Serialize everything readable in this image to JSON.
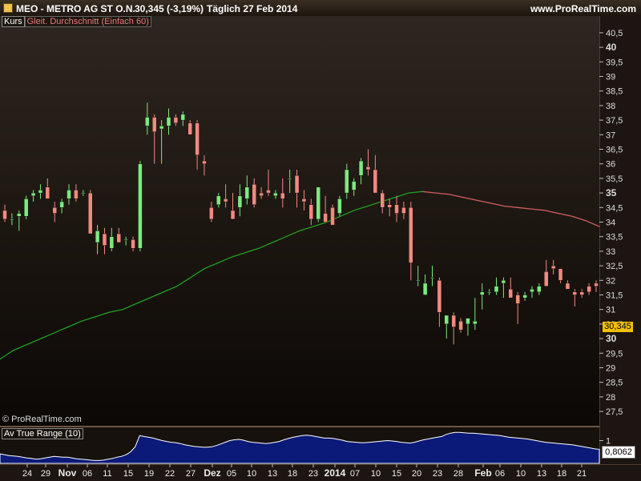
{
  "header": {
    "symbol": "MEO - METRO AG ST O.N.",
    "price_change": "30,345 (-3,19%)",
    "interval_date": "Täglich  27 Feb 2014",
    "site": "www.ProRealTime.com",
    "swatch_color": "#f2c34c"
  },
  "legend": {
    "kurs": "Kurs",
    "ma": "Gleit. Durchschnitt (Einfach 60)"
  },
  "copyright": "© ProRealTime.com",
  "atr": {
    "label": "Av True Range (10)",
    "value": "0,8062",
    "axis_tick": "1"
  },
  "current_price": "30,345",
  "x_ticks": [
    "24",
    "29",
    "Nov",
    "06",
    "11",
    "15",
    "19",
    "22",
    "27",
    "Dez",
    "05",
    "10",
    "13",
    "18",
    "23",
    "2014",
    "07",
    "10",
    "15",
    "20",
    "23",
    "28",
    "Feb",
    "06",
    "10",
    "13",
    "18",
    "21"
  ],
  "y_ticks": [
    "40,5",
    "40",
    "39,5",
    "39",
    "38,5",
    "38",
    "37,5",
    "37",
    "36,5",
    "36",
    "35,5",
    "35",
    "34,5",
    "34",
    "33,5",
    "33",
    "32,5",
    "32",
    "31,5",
    "31",
    "30,5",
    "30",
    "29,5",
    "29",
    "28,5",
    "28",
    "27,5"
  ],
  "colors": {
    "up": "#7ee87e",
    "down": "#f08a80",
    "ma_green": "#1fa01f",
    "ma_red": "#d06060",
    "atr_fill": "#0b1a78"
  },
  "chart_data": {
    "type": "candlestick",
    "y_range": [
      27.2,
      40.8
    ],
    "ma_label": "Gleit. Durchschnitt (Einfach 60)",
    "ma": [
      29.3,
      29.6,
      29.8,
      30.0,
      30.2,
      30.4,
      30.6,
      30.75,
      30.9,
      31.0,
      31.2,
      31.4,
      31.6,
      31.8,
      32.1,
      32.4,
      32.6,
      32.8,
      32.95,
      33.1,
      33.3,
      33.5,
      33.7,
      33.85,
      34.0,
      34.2,
      34.4,
      34.55,
      34.7,
      34.85,
      35.0,
      35.05,
      35.0,
      34.95,
      34.85,
      34.75,
      34.65,
      34.55,
      34.5,
      34.45,
      34.4,
      34.3,
      34.2,
      34.05,
      33.85
    ],
    "candles": [
      [
        34.4,
        34.6,
        34.0,
        34.1
      ],
      [
        34.1,
        34.3,
        33.9,
        34.1
      ],
      [
        34.2,
        34.4,
        33.7,
        34.3
      ],
      [
        34.2,
        34.9,
        34.1,
        34.8
      ],
      [
        34.9,
        35.1,
        34.7,
        35.0
      ],
      [
        35.0,
        35.3,
        34.8,
        35.1
      ],
      [
        35.2,
        35.5,
        34.8,
        34.8
      ],
      [
        34.5,
        34.7,
        34.0,
        34.3
      ],
      [
        34.5,
        34.8,
        34.3,
        34.7
      ],
      [
        34.8,
        35.3,
        34.6,
        35.1
      ],
      [
        35.1,
        35.3,
        34.7,
        34.8
      ],
      [
        35.0,
        35.1,
        34.9,
        35.0
      ],
      [
        35.0,
        35.1,
        33.7,
        33.6
      ],
      [
        33.3,
        33.9,
        32.9,
        33.7
      ],
      [
        33.6,
        33.8,
        32.9,
        33.2
      ],
      [
        33.1,
        33.8,
        33.0,
        33.5
      ],
      [
        33.6,
        33.8,
        33.3,
        33.3
      ],
      [
        33.4,
        33.5,
        33.2,
        33.4
      ],
      [
        33.4,
        33.5,
        33.0,
        33.1
      ],
      [
        33.1,
        36.1,
        33.0,
        36.0
      ],
      [
        37.3,
        38.1,
        37.0,
        37.6
      ],
      [
        37.6,
        37.7,
        36.0,
        37.1
      ],
      [
        37.2,
        37.5,
        36.0,
        37.3
      ],
      [
        37.3,
        37.9,
        37.0,
        37.6
      ],
      [
        37.6,
        37.7,
        37.3,
        37.4
      ],
      [
        37.5,
        37.8,
        37.3,
        37.7
      ],
      [
        37.4,
        37.5,
        37.0,
        37.0
      ],
      [
        37.4,
        37.5,
        35.8,
        36.3
      ],
      [
        36.1,
        36.3,
        35.6,
        36.0
      ],
      [
        34.5,
        34.7,
        34.0,
        34.1
      ],
      [
        34.6,
        35.0,
        34.5,
        34.9
      ],
      [
        34.8,
        35.3,
        34.5,
        34.7
      ],
      [
        34.4,
        35.0,
        34.1,
        34.1
      ],
      [
        34.5,
        35.3,
        34.2,
        34.9
      ],
      [
        34.8,
        35.6,
        34.6,
        35.2
      ],
      [
        35.3,
        35.5,
        34.5,
        34.6
      ],
      [
        35.0,
        35.2,
        34.8,
        34.9
      ],
      [
        35.1,
        35.8,
        34.9,
        35.0
      ],
      [
        34.9,
        35.1,
        34.8,
        35.0
      ],
      [
        35.0,
        35.5,
        34.5,
        34.8
      ],
      [
        35.5,
        35.8,
        35.0,
        35.5
      ],
      [
        35.6,
        35.8,
        34.5,
        35.0
      ],
      [
        34.8,
        35.1,
        34.4,
        34.7
      ],
      [
        34.6,
        34.8,
        33.9,
        34.1
      ],
      [
        34.1,
        35.1,
        34.0,
        35.2
      ],
      [
        34.3,
        34.9,
        34.0,
        34.0
      ],
      [
        34.5,
        34.6,
        33.9,
        33.9
      ],
      [
        34.3,
        34.9,
        34.2,
        34.8
      ],
      [
        35.0,
        36.0,
        34.8,
        35.8
      ],
      [
        35.1,
        35.5,
        34.9,
        35.4
      ],
      [
        35.6,
        36.2,
        35.3,
        36.1
      ],
      [
        35.9,
        36.5,
        35.6,
        35.8
      ],
      [
        35.8,
        36.3,
        35.1,
        35.0
      ],
      [
        35.0,
        35.1,
        34.3,
        34.5
      ],
      [
        34.6,
        34.8,
        34.2,
        34.5
      ],
      [
        34.6,
        34.9,
        34.0,
        34.3
      ],
      [
        34.5,
        34.7,
        34.1,
        34.3
      ],
      [
        34.5,
        34.7,
        32.0,
        32.6
      ],
      [
        32.0,
        32.5,
        31.8,
        32.0
      ],
      [
        31.5,
        32.2,
        31.5,
        31.9
      ],
      [
        32.1,
        32.5,
        31.8,
        32.1
      ],
      [
        32.0,
        32.1,
        30.4,
        30.9
      ],
      [
        30.5,
        30.8,
        30.0,
        30.8
      ],
      [
        30.8,
        30.9,
        29.8,
        30.4
      ],
      [
        30.6,
        30.7,
        30.2,
        30.3
      ],
      [
        30.5,
        30.7,
        30.1,
        30.7
      ],
      [
        30.5,
        31.4,
        30.3,
        30.6
      ],
      [
        31.5,
        31.9,
        31.0,
        31.6
      ],
      [
        31.6,
        31.7,
        31.5,
        31.6
      ],
      [
        31.6,
        32.1,
        31.5,
        31.8
      ],
      [
        31.9,
        32.1,
        31.4,
        32.0
      ],
      [
        31.7,
        32.1,
        31.5,
        31.4
      ],
      [
        31.5,
        31.6,
        30.5,
        31.2
      ],
      [
        31.4,
        31.6,
        31.3,
        31.5
      ],
      [
        31.6,
        31.8,
        31.4,
        31.7
      ],
      [
        31.6,
        31.9,
        31.5,
        31.8
      ],
      [
        32.3,
        32.7,
        31.9,
        31.8
      ],
      [
        32.5,
        32.7,
        32.2,
        32.4
      ],
      [
        32.4,
        32.4,
        31.9,
        32.0
      ],
      [
        31.9,
        32.0,
        31.7,
        31.7
      ],
      [
        31.6,
        31.7,
        31.1,
        31.5
      ],
      [
        31.6,
        31.7,
        31.4,
        31.5
      ],
      [
        31.8,
        31.9,
        31.5,
        31.6
      ],
      [
        31.9,
        32.0,
        31.6,
        31.8
      ]
    ],
    "atr_values": [
      0.68,
      0.66,
      0.64,
      0.63,
      0.62,
      0.6,
      0.58,
      0.57,
      0.55,
      0.56,
      0.58,
      0.6,
      0.62,
      0.61,
      0.6,
      0.6,
      0.58,
      0.56,
      0.55,
      0.54,
      0.53,
      0.52,
      0.52,
      0.53,
      0.55,
      0.57,
      0.6,
      0.62,
      0.66,
      0.73,
      0.85,
      1.12,
      1.1,
      1.08,
      1.06,
      1.03,
      1.0,
      0.98,
      0.96,
      0.95,
      0.93,
      0.9,
      0.88,
      0.86,
      0.85,
      0.84,
      0.84,
      0.85,
      0.88,
      0.92,
      0.96,
      1.0,
      1.02,
      1.03,
      1.01,
      0.98,
      0.96,
      0.95,
      0.94,
      0.93,
      0.94,
      0.96,
      0.98,
      1.02,
      1.05,
      1.08,
      1.1,
      1.12,
      1.13,
      1.12,
      1.1,
      1.08,
      1.06,
      1.06,
      1.05,
      1.03,
      1.01,
      0.98,
      0.97,
      0.96,
      0.95,
      0.95,
      0.96,
      0.97,
      0.98,
      0.99,
      1.0,
      0.99,
      0.98,
      0.96,
      0.95,
      0.94,
      0.96,
      0.99,
      1.02,
      1.04,
      1.06,
      1.08,
      1.1,
      1.15,
      1.18,
      1.2,
      1.2,
      1.19,
      1.18,
      1.18,
      1.17,
      1.16,
      1.15,
      1.14,
      1.13,
      1.12,
      1.1,
      1.08,
      1.07,
      1.06,
      1.05,
      1.04,
      1.02,
      1.0,
      0.98,
      0.96,
      0.95,
      0.94,
      0.93,
      0.92,
      0.91,
      0.9,
      0.88,
      0.86,
      0.84,
      0.82,
      0.8,
      0.79
    ]
  }
}
